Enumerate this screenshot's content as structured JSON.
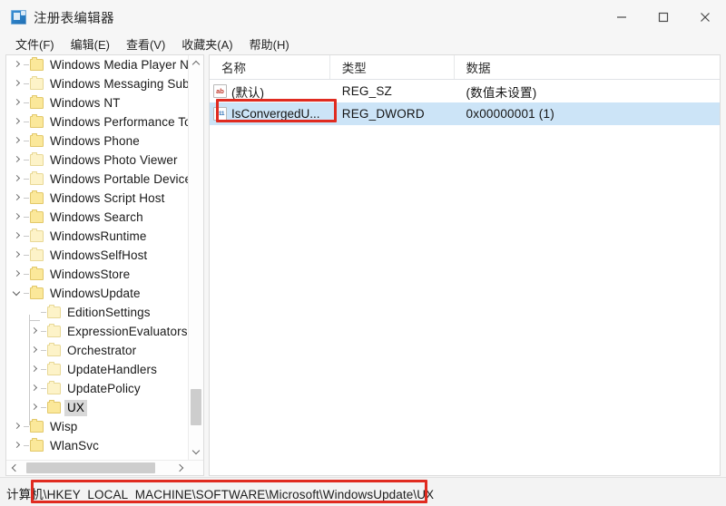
{
  "window": {
    "title": "注册表编辑器",
    "icon": "registry-editor-icon",
    "controls": {
      "minimize": "最小化",
      "maximize": "最大化",
      "close": "关闭"
    }
  },
  "menubar": {
    "items": [
      {
        "label": "文件(F)"
      },
      {
        "label": "编辑(E)"
      },
      {
        "label": "查看(V)"
      },
      {
        "label": "收藏夹(A)"
      },
      {
        "label": "帮助(H)"
      }
    ]
  },
  "tree": {
    "items": [
      {
        "label": "Windows Media Player NS",
        "indent": 0,
        "expander": "right",
        "selected": false
      },
      {
        "label": "Windows Messaging Subs",
        "indent": 0,
        "expander": "right",
        "selected": false
      },
      {
        "label": "Windows NT",
        "indent": 0,
        "expander": "right",
        "selected": false
      },
      {
        "label": "Windows Performance To",
        "indent": 0,
        "expander": "right",
        "selected": false
      },
      {
        "label": "Windows Phone",
        "indent": 0,
        "expander": "right",
        "selected": false
      },
      {
        "label": "Windows Photo Viewer",
        "indent": 0,
        "expander": "right",
        "selected": false
      },
      {
        "label": "Windows Portable Devices",
        "indent": 0,
        "expander": "right",
        "selected": false
      },
      {
        "label": "Windows Script Host",
        "indent": 0,
        "expander": "right",
        "selected": false
      },
      {
        "label": "Windows Search",
        "indent": 0,
        "expander": "right",
        "selected": false
      },
      {
        "label": "WindowsRuntime",
        "indent": 0,
        "expander": "right",
        "selected": false
      },
      {
        "label": "WindowsSelfHost",
        "indent": 0,
        "expander": "right",
        "selected": false
      },
      {
        "label": "WindowsStore",
        "indent": 0,
        "expander": "right",
        "selected": false
      },
      {
        "label": "WindowsUpdate",
        "indent": 0,
        "expander": "down",
        "selected": false
      },
      {
        "label": "EditionSettings",
        "indent": 1,
        "expander": "none",
        "selected": false
      },
      {
        "label": "ExpressionEvaluators",
        "indent": 1,
        "expander": "right",
        "selected": false
      },
      {
        "label": "Orchestrator",
        "indent": 1,
        "expander": "right",
        "selected": false
      },
      {
        "label": "UpdateHandlers",
        "indent": 1,
        "expander": "right",
        "selected": false
      },
      {
        "label": "UpdatePolicy",
        "indent": 1,
        "expander": "right",
        "selected": false
      },
      {
        "label": "UX",
        "indent": 1,
        "expander": "right",
        "selected": true
      },
      {
        "label": "Wisp",
        "indent": 0,
        "expander": "right",
        "selected": false
      },
      {
        "label": "WlanSvc",
        "indent": 0,
        "expander": "right",
        "selected": false
      }
    ]
  },
  "list": {
    "columns": [
      {
        "label": "名称"
      },
      {
        "label": "类型"
      },
      {
        "label": "数据"
      }
    ],
    "rows": [
      {
        "icon": "reg-sz-icon",
        "icon_glyph": "ab",
        "name": "(默认)",
        "type": "REG_SZ",
        "data": "(数值未设置)",
        "selected": false
      },
      {
        "icon": "reg-dword-icon",
        "icon_glyph": "011",
        "name": "IsConvergedU...",
        "type": "REG_DWORD",
        "data": "0x00000001 (1)",
        "selected": true
      }
    ]
  },
  "statusbar": {
    "path": "计算机\\HKEY_LOCAL_MACHINE\\SOFTWARE\\Microsoft\\WindowsUpdate\\UX"
  },
  "annotations": {
    "color": "#e02b20",
    "boxes": [
      {
        "target": "value-name-cell"
      },
      {
        "target": "status-path"
      }
    ]
  }
}
